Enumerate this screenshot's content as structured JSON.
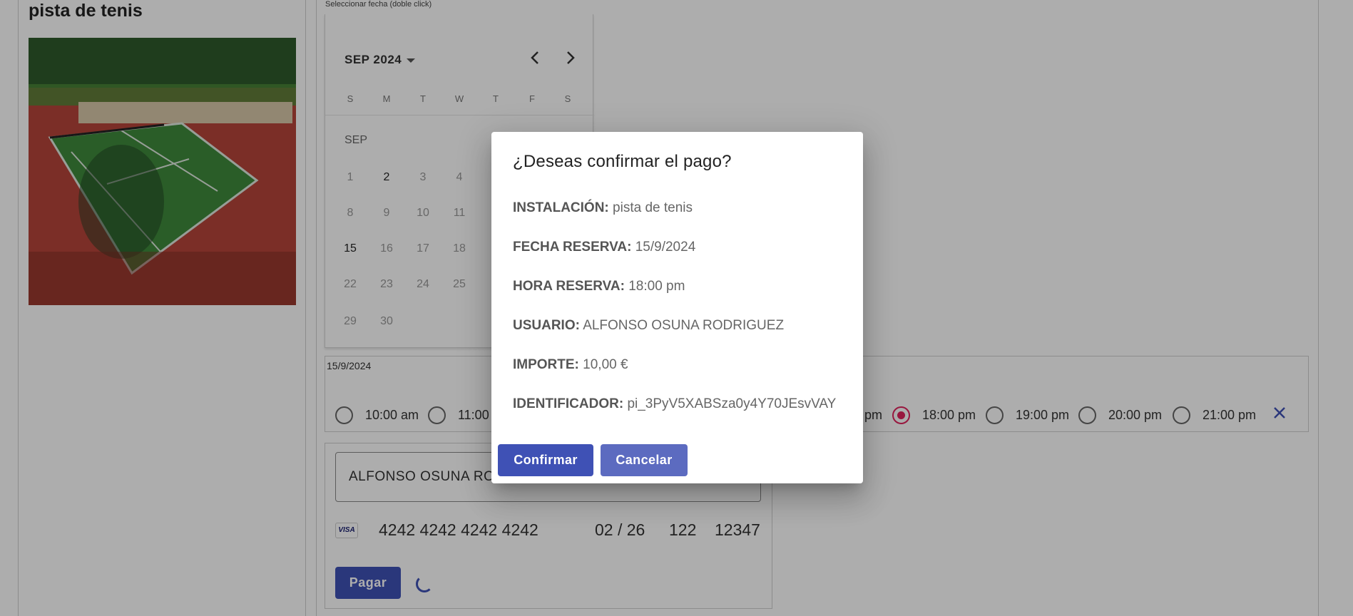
{
  "facility": {
    "title": "pista de tenis"
  },
  "calendar": {
    "hint": "Seleccionar fecha (doble click)",
    "header": "SEP 2024",
    "month_label": "SEP",
    "weekdays": [
      "S",
      "M",
      "T",
      "W",
      "T",
      "F",
      "S"
    ],
    "days": [
      "1",
      "2",
      "3",
      "4",
      "8",
      "9",
      "10",
      "11",
      "15",
      "16",
      "17",
      "18",
      "22",
      "23",
      "24",
      "25",
      "29",
      "30"
    ]
  },
  "date_field": {
    "value": "15/9/2024"
  },
  "time_slots": [
    {
      "label": "10:00 am",
      "selected": false
    },
    {
      "label": "11:00",
      "selected": false
    },
    {
      "label": "pm",
      "selected": false
    },
    {
      "label": "18:00 pm",
      "selected": true
    },
    {
      "label": "19:00 pm",
      "selected": false
    },
    {
      "label": "20:00 pm",
      "selected": false
    },
    {
      "label": "21:00 pm",
      "selected": false
    }
  ],
  "payment": {
    "name": "ALFONSO OSUNA RO",
    "card_brand": "VISA",
    "card_number": "4242 4242 4242 4242",
    "expiry": "02 / 26",
    "cvc": "122",
    "zip": "12347",
    "pay_label": "Pagar"
  },
  "dialog": {
    "title": "¿Deseas confirmar el pago?",
    "fields": [
      {
        "label": "INSTALACIÓN:",
        "value": "pista de tenis"
      },
      {
        "label": "FECHA RESERVA:",
        "value": "15/9/2024"
      },
      {
        "label": "HORA RESERVA:",
        "value": "18:00 pm"
      },
      {
        "label": "USUARIO:",
        "value": "ALFONSO OSUNA RODRIGUEZ"
      },
      {
        "label": "IMPORTE:",
        "value": "10,00 €"
      },
      {
        "label": "IDENTIFICADOR:",
        "value": "pi_3PyV5XABSza0y4Y70JEsvVAY"
      }
    ],
    "confirm_label": "Confirmar",
    "cancel_label": "Cancelar"
  },
  "colors": {
    "primary": "#3f51b5",
    "cancel": "#5c6bc0",
    "radio_selected": "#e0245e"
  }
}
